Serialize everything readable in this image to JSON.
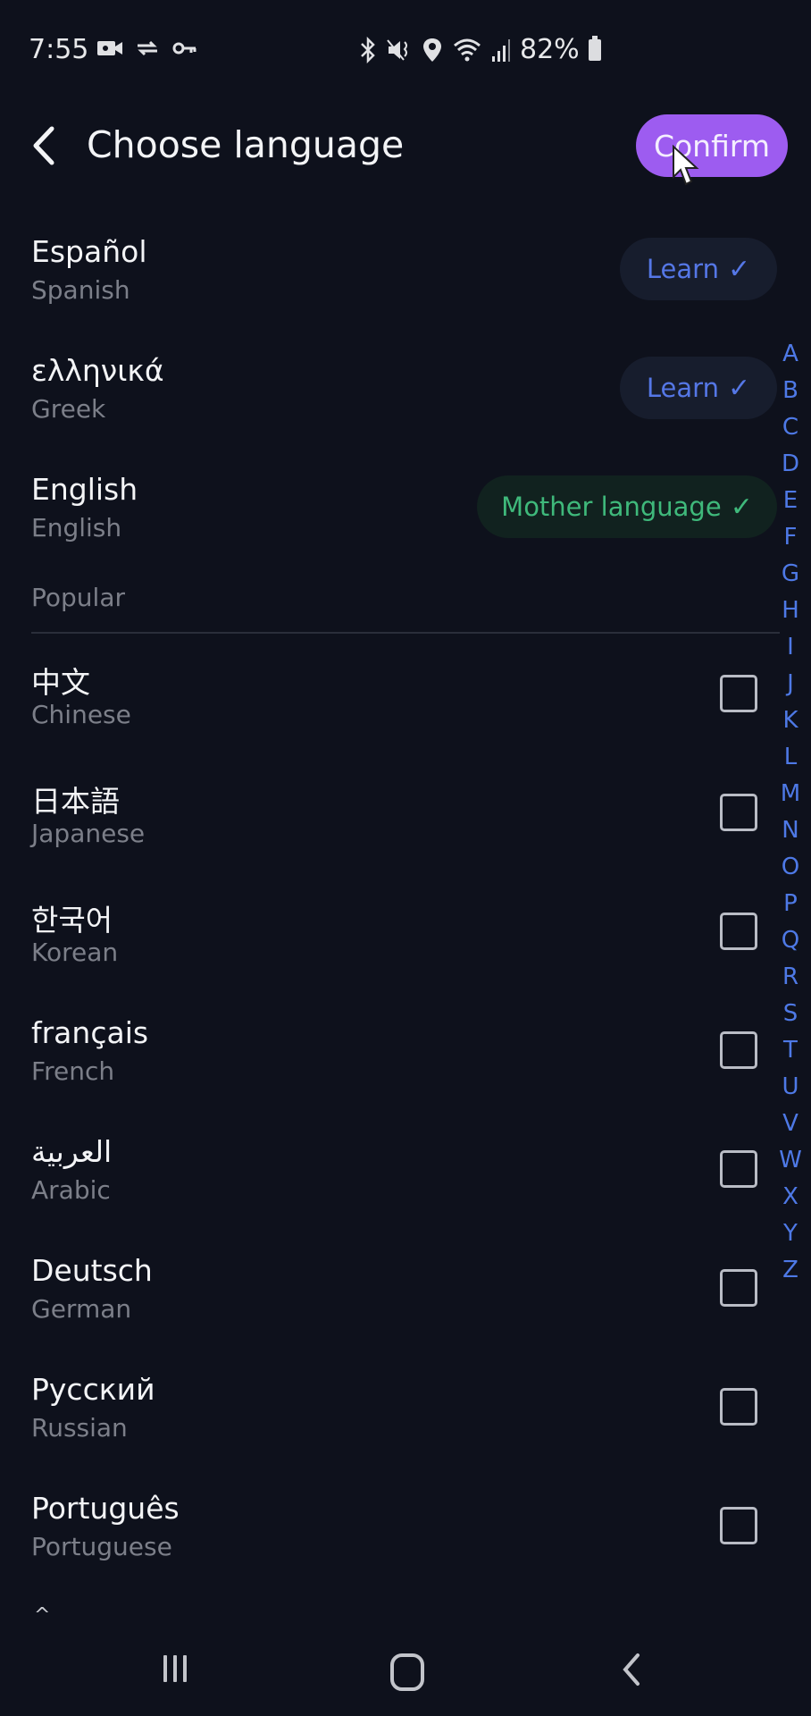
{
  "status_bar": {
    "time": "7:55",
    "left_icons": [
      "video-camera-icon",
      "sync-icon",
      "vpn-key-icon"
    ],
    "right_icons": [
      "bluetooth-icon",
      "mute-vibrate-icon",
      "location-icon",
      "wifi-icon",
      "signal-icon"
    ],
    "battery_percent": "82%"
  },
  "header": {
    "back_icon": "chevron-left-icon",
    "title": "Choose language",
    "confirm_label": "Confirm",
    "confirm_color": "#9d5cf0"
  },
  "selected_languages": [
    {
      "native": "Español",
      "english": "Spanish",
      "status": "Learn",
      "status_type": "learn"
    },
    {
      "native": "ελληνικά",
      "english": "Greek",
      "status": "Learn",
      "status_type": "learn"
    },
    {
      "native": "English",
      "english": "English",
      "status": "Mother language",
      "status_type": "mother"
    }
  ],
  "section_label": "Popular",
  "popular_languages": [
    {
      "native": "中文",
      "english": "Chinese",
      "checked": false
    },
    {
      "native": "日本語",
      "english": "Japanese",
      "checked": false
    },
    {
      "native": "한국어",
      "english": "Korean",
      "checked": false
    },
    {
      "native": "français",
      "english": "French",
      "checked": false
    },
    {
      "native": "العربية",
      "english": "Arabic",
      "checked": false
    },
    {
      "native": "Deutsch",
      "english": "German",
      "checked": false
    },
    {
      "native": "Русский",
      "english": "Russian",
      "checked": false
    },
    {
      "native": "Português",
      "english": "Portuguese",
      "checked": false
    }
  ],
  "alphabet_index": [
    "A",
    "B",
    "C",
    "D",
    "E",
    "F",
    "G",
    "H",
    "I",
    "J",
    "K",
    "L",
    "M",
    "N",
    "O",
    "P",
    "Q",
    "R",
    "S",
    "T",
    "U",
    "V",
    "W",
    "X",
    "Y",
    "Z"
  ],
  "scroll_indicator": "^",
  "colors": {
    "background": "#0e111c",
    "learn_text": "#5577e6",
    "mother_text": "#3fb97b",
    "index_text": "#4e79e6"
  },
  "nav_bar": [
    "recents-icon",
    "home-icon",
    "back-icon"
  ]
}
